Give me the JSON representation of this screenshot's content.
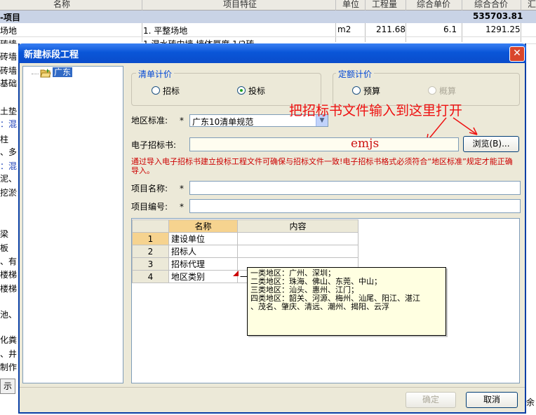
{
  "background": {
    "header": {
      "col_name": "名称",
      "col_feature": "项目特征",
      "col_unit": "单位",
      "col_qty": "工程量",
      "col_unit_price": "综合单价",
      "col_total": "综合合价",
      "col_extra": "汇"
    },
    "total_row": {
      "label": "-项目",
      "amount": "535703.81"
    },
    "row1": {
      "name": "场地",
      "feature": "1. 平整场地",
      "unit": "m2",
      "qty": "211.68",
      "unit_price": "6.1",
      "total": "1291.25"
    },
    "row2": {
      "name": "砖墙",
      "feature": "1.混水砖内墙 墙体厚度 1/2砖"
    },
    "left_labels": [
      "砖墙",
      "砖墙",
      "基础",
      "土垫",
      "：混",
      "柱",
      "、多",
      "：混",
      "泥、",
      "挖淤",
      "梁",
      "板",
      "、有",
      "楼梯",
      "楼梯",
      "池、",
      "化粪",
      "、井",
      "制作"
    ],
    "bottom_tab": "示",
    "right_edge": "余"
  },
  "dialog": {
    "title": "新建标段工程",
    "tree_item": "广东",
    "bill_group": {
      "title": "清单计价",
      "option1": "招标",
      "option2": "投标",
      "selected": "投标"
    },
    "quota_group": {
      "title": "定额计价",
      "option1": "预算",
      "option2": "概算"
    },
    "region_label": "地区标准:",
    "region_value": "广东10清单规范",
    "ebid_label": "电子招标书:",
    "browse_label": "浏览(B)...",
    "ebid_value": "emjs",
    "note": "通过导入电子招标书建立投标工程文件可确保与招标文件一致!电子招标书格式必须符合“地区标准”规定才能正确导入。",
    "project_name_label": "项目名称:",
    "project_code_label": "项目编号:",
    "required_mark": "*",
    "annotation": "把招标书文件输入到这里打开",
    "grid": {
      "headers": [
        "名称",
        "内容"
      ],
      "rows": [
        {
          "num": "1",
          "name": "建设单位",
          "content": ""
        },
        {
          "num": "2",
          "name": "招标人",
          "content": ""
        },
        {
          "num": "3",
          "name": "招标代理",
          "content": ""
        },
        {
          "num": "4",
          "name": "地区类别",
          "content": "一"
        }
      ]
    },
    "tooltip": [
      "一类地区：广州、深圳；",
      "二类地区：珠海、佛山、东莞、中山；",
      "三类地区：汕头、惠州、江门；",
      "四类地区：韶关、河源、梅州、汕尾、阳江、湛江",
      "、茂名、肇庆、清远、潮州、揭阳、云浮"
    ],
    "ok_label": "确定",
    "cancel_label": "取消",
    "colors": {
      "title_bar": "#0a56d8",
      "note_red": "#cc0000",
      "annotation_red": "#ee1111"
    }
  }
}
